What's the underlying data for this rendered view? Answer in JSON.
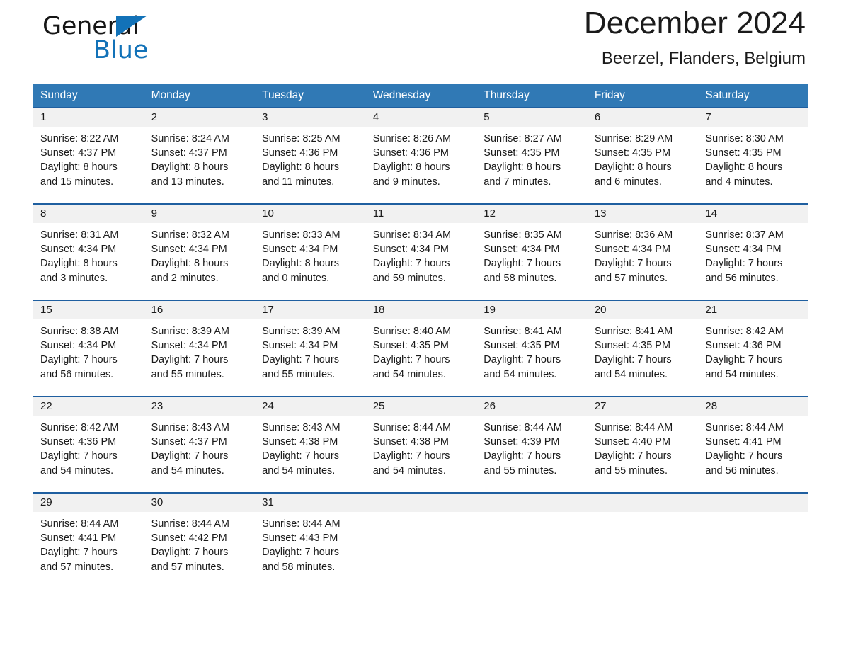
{
  "brand": {
    "name_part1": "General",
    "name_part2": "Blue",
    "logo_icon": "triangle-icon",
    "accent_color": "#1272b8"
  },
  "header": {
    "title": "December 2024",
    "subtitle": "Beerzel, Flanders, Belgium"
  },
  "colors": {
    "header_blue": "#3079b5",
    "row_divider_blue": "#1f5fa0",
    "daynum_background": "#f1f1f1",
    "text": "#1a1a1a"
  },
  "calendar": {
    "day_headers": [
      "Sunday",
      "Monday",
      "Tuesday",
      "Wednesday",
      "Thursday",
      "Friday",
      "Saturday"
    ],
    "weeks": [
      {
        "days": [
          {
            "num": "1",
            "sunrise": "Sunrise: 8:22 AM",
            "sunset": "Sunset: 4:37 PM",
            "daylight_1": "Daylight: 8 hours",
            "daylight_2": "and 15 minutes."
          },
          {
            "num": "2",
            "sunrise": "Sunrise: 8:24 AM",
            "sunset": "Sunset: 4:37 PM",
            "daylight_1": "Daylight: 8 hours",
            "daylight_2": "and 13 minutes."
          },
          {
            "num": "3",
            "sunrise": "Sunrise: 8:25 AM",
            "sunset": "Sunset: 4:36 PM",
            "daylight_1": "Daylight: 8 hours",
            "daylight_2": "and 11 minutes."
          },
          {
            "num": "4",
            "sunrise": "Sunrise: 8:26 AM",
            "sunset": "Sunset: 4:36 PM",
            "daylight_1": "Daylight: 8 hours",
            "daylight_2": "and 9 minutes."
          },
          {
            "num": "5",
            "sunrise": "Sunrise: 8:27 AM",
            "sunset": "Sunset: 4:35 PM",
            "daylight_1": "Daylight: 8 hours",
            "daylight_2": "and 7 minutes."
          },
          {
            "num": "6",
            "sunrise": "Sunrise: 8:29 AM",
            "sunset": "Sunset: 4:35 PM",
            "daylight_1": "Daylight: 8 hours",
            "daylight_2": "and 6 minutes."
          },
          {
            "num": "7",
            "sunrise": "Sunrise: 8:30 AM",
            "sunset": "Sunset: 4:35 PM",
            "daylight_1": "Daylight: 8 hours",
            "daylight_2": "and 4 minutes."
          }
        ]
      },
      {
        "days": [
          {
            "num": "8",
            "sunrise": "Sunrise: 8:31 AM",
            "sunset": "Sunset: 4:34 PM",
            "daylight_1": "Daylight: 8 hours",
            "daylight_2": "and 3 minutes."
          },
          {
            "num": "9",
            "sunrise": "Sunrise: 8:32 AM",
            "sunset": "Sunset: 4:34 PM",
            "daylight_1": "Daylight: 8 hours",
            "daylight_2": "and 2 minutes."
          },
          {
            "num": "10",
            "sunrise": "Sunrise: 8:33 AM",
            "sunset": "Sunset: 4:34 PM",
            "daylight_1": "Daylight: 8 hours",
            "daylight_2": "and 0 minutes."
          },
          {
            "num": "11",
            "sunrise": "Sunrise: 8:34 AM",
            "sunset": "Sunset: 4:34 PM",
            "daylight_1": "Daylight: 7 hours",
            "daylight_2": "and 59 minutes."
          },
          {
            "num": "12",
            "sunrise": "Sunrise: 8:35 AM",
            "sunset": "Sunset: 4:34 PM",
            "daylight_1": "Daylight: 7 hours",
            "daylight_2": "and 58 minutes."
          },
          {
            "num": "13",
            "sunrise": "Sunrise: 8:36 AM",
            "sunset": "Sunset: 4:34 PM",
            "daylight_1": "Daylight: 7 hours",
            "daylight_2": "and 57 minutes."
          },
          {
            "num": "14",
            "sunrise": "Sunrise: 8:37 AM",
            "sunset": "Sunset: 4:34 PM",
            "daylight_1": "Daylight: 7 hours",
            "daylight_2": "and 56 minutes."
          }
        ]
      },
      {
        "days": [
          {
            "num": "15",
            "sunrise": "Sunrise: 8:38 AM",
            "sunset": "Sunset: 4:34 PM",
            "daylight_1": "Daylight: 7 hours",
            "daylight_2": "and 56 minutes."
          },
          {
            "num": "16",
            "sunrise": "Sunrise: 8:39 AM",
            "sunset": "Sunset: 4:34 PM",
            "daylight_1": "Daylight: 7 hours",
            "daylight_2": "and 55 minutes."
          },
          {
            "num": "17",
            "sunrise": "Sunrise: 8:39 AM",
            "sunset": "Sunset: 4:34 PM",
            "daylight_1": "Daylight: 7 hours",
            "daylight_2": "and 55 minutes."
          },
          {
            "num": "18",
            "sunrise": "Sunrise: 8:40 AM",
            "sunset": "Sunset: 4:35 PM",
            "daylight_1": "Daylight: 7 hours",
            "daylight_2": "and 54 minutes."
          },
          {
            "num": "19",
            "sunrise": "Sunrise: 8:41 AM",
            "sunset": "Sunset: 4:35 PM",
            "daylight_1": "Daylight: 7 hours",
            "daylight_2": "and 54 minutes."
          },
          {
            "num": "20",
            "sunrise": "Sunrise: 8:41 AM",
            "sunset": "Sunset: 4:35 PM",
            "daylight_1": "Daylight: 7 hours",
            "daylight_2": "and 54 minutes."
          },
          {
            "num": "21",
            "sunrise": "Sunrise: 8:42 AM",
            "sunset": "Sunset: 4:36 PM",
            "daylight_1": "Daylight: 7 hours",
            "daylight_2": "and 54 minutes."
          }
        ]
      },
      {
        "days": [
          {
            "num": "22",
            "sunrise": "Sunrise: 8:42 AM",
            "sunset": "Sunset: 4:36 PM",
            "daylight_1": "Daylight: 7 hours",
            "daylight_2": "and 54 minutes."
          },
          {
            "num": "23",
            "sunrise": "Sunrise: 8:43 AM",
            "sunset": "Sunset: 4:37 PM",
            "daylight_1": "Daylight: 7 hours",
            "daylight_2": "and 54 minutes."
          },
          {
            "num": "24",
            "sunrise": "Sunrise: 8:43 AM",
            "sunset": "Sunset: 4:38 PM",
            "daylight_1": "Daylight: 7 hours",
            "daylight_2": "and 54 minutes."
          },
          {
            "num": "25",
            "sunrise": "Sunrise: 8:44 AM",
            "sunset": "Sunset: 4:38 PM",
            "daylight_1": "Daylight: 7 hours",
            "daylight_2": "and 54 minutes."
          },
          {
            "num": "26",
            "sunrise": "Sunrise: 8:44 AM",
            "sunset": "Sunset: 4:39 PM",
            "daylight_1": "Daylight: 7 hours",
            "daylight_2": "and 55 minutes."
          },
          {
            "num": "27",
            "sunrise": "Sunrise: 8:44 AM",
            "sunset": "Sunset: 4:40 PM",
            "daylight_1": "Daylight: 7 hours",
            "daylight_2": "and 55 minutes."
          },
          {
            "num": "28",
            "sunrise": "Sunrise: 8:44 AM",
            "sunset": "Sunset: 4:41 PM",
            "daylight_1": "Daylight: 7 hours",
            "daylight_2": "and 56 minutes."
          }
        ]
      },
      {
        "days": [
          {
            "num": "29",
            "sunrise": "Sunrise: 8:44 AM",
            "sunset": "Sunset: 4:41 PM",
            "daylight_1": "Daylight: 7 hours",
            "daylight_2": "and 57 minutes."
          },
          {
            "num": "30",
            "sunrise": "Sunrise: 8:44 AM",
            "sunset": "Sunset: 4:42 PM",
            "daylight_1": "Daylight: 7 hours",
            "daylight_2": "and 57 minutes."
          },
          {
            "num": "31",
            "sunrise": "Sunrise: 8:44 AM",
            "sunset": "Sunset: 4:43 PM",
            "daylight_1": "Daylight: 7 hours",
            "daylight_2": "and 58 minutes."
          },
          {
            "num": "",
            "sunrise": "",
            "sunset": "",
            "daylight_1": "",
            "daylight_2": ""
          },
          {
            "num": "",
            "sunrise": "",
            "sunset": "",
            "daylight_1": "",
            "daylight_2": ""
          },
          {
            "num": "",
            "sunrise": "",
            "sunset": "",
            "daylight_1": "",
            "daylight_2": ""
          },
          {
            "num": "",
            "sunrise": "",
            "sunset": "",
            "daylight_1": "",
            "daylight_2": ""
          }
        ]
      }
    ]
  }
}
